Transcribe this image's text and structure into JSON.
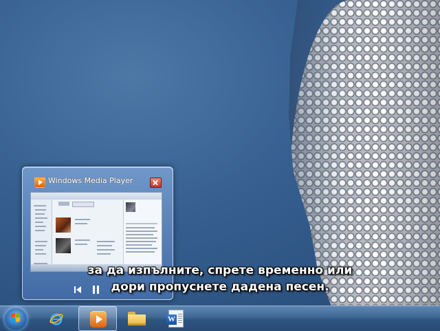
{
  "preview": {
    "title": "Windows Media Player"
  },
  "subtitle": {
    "line1": "за да изпълните, спрете временно или",
    "line2": "дори пропуснете дадена песен."
  },
  "taskbar": {
    "items": [
      {
        "name": "start",
        "icon": "windows-flag-icon"
      },
      {
        "name": "internet-explorer",
        "icon": "ie-icon"
      },
      {
        "name": "windows-media-player",
        "icon": "wmp-icon",
        "active": true
      },
      {
        "name": "windows-explorer",
        "icon": "folder-icon"
      },
      {
        "name": "microsoft-word",
        "icon": "word-icon"
      }
    ],
    "word_glyph": "W"
  },
  "colors": {
    "desktop": "#365f90",
    "taskbar": "#3f6794",
    "wmp_orange": "#e06010"
  }
}
